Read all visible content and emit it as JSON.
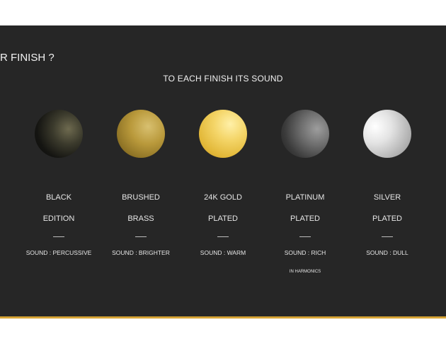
{
  "heading": "R FINISH ?",
  "subheading": "TO EACH FINISH ITS SOUND",
  "finishes": [
    {
      "line1": "BLACK",
      "line2": "EDITION",
      "sound": "SOUND : PERCUSSIVE",
      "extra": ""
    },
    {
      "line1": "BRUSHED",
      "line2": "BRASS",
      "sound": "SOUND : BRIGHTER",
      "extra": ""
    },
    {
      "line1": "24K GOLD",
      "line2": "PLATED",
      "sound": "SOUND : WARM",
      "extra": ""
    },
    {
      "line1": "PLATINUM",
      "line2": "PLATED",
      "sound": "SOUND : RICH",
      "extra": "IN HARMONICS"
    },
    {
      "line1": "SILVER",
      "line2": "PLATED",
      "sound": "SOUND : DULL",
      "extra": ""
    }
  ],
  "colors": {
    "panel_background": "#262626",
    "accent_line": "#d7a436",
    "text": "#e6e6e6"
  }
}
